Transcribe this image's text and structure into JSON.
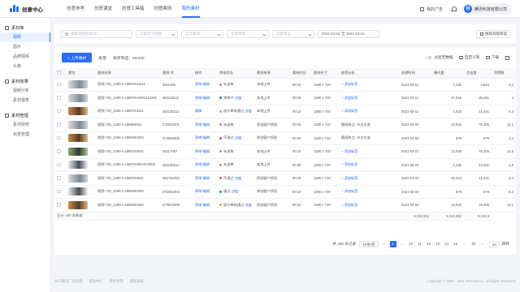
{
  "app": {
    "title": "创意中心"
  },
  "nav": [
    "创意参考",
    "创意课堂",
    "创意工具箱",
    "创意案例",
    "我的素材"
  ],
  "nav_active_index": 4,
  "header_right": {
    "ad_label": "我的广告",
    "user_initial": "腾",
    "user_name": "腾讯科技有限公司"
  },
  "sidebar": [
    {
      "label": "素材库",
      "items": [
        "视频",
        "图片",
        "品牌视频",
        "头像"
      ],
      "active_item": 0
    },
    {
      "label": "素材效果",
      "items": [
        "视频分析",
        "素材报表"
      ]
    },
    {
      "label": "素材管理",
      "items": [
        "素材授权",
        "标签管理"
      ]
    }
  ],
  "filters": {
    "search_placeholder": "搜索视频名称/ID",
    "selects": [
      "全部尺寸规格",
      "全部来源",
      "全部场景",
      "全部状态"
    ],
    "date_range": "2021-03-01 至 2021-04-01",
    "advanced": "视频高级筛选"
  },
  "toolbar": {
    "upload": "+ 上传素材",
    "tabs": [
      "批量",
      "排序筛选：20/100"
    ],
    "filter_toggle": "过滤无数据",
    "custom_columns": "自定义列",
    "download": "下载"
  },
  "table": {
    "columns": [
      "预览",
      "素材名称",
      "素材 ID",
      "操作",
      "审核状态",
      "素材来源",
      "素材时长",
      "素材尺寸",
      "推荐分析",
      "创建时间",
      "曝光量",
      "点击量",
      "消费数"
    ],
    "rows": [
      {
        "thumb": 0,
        "name": "视频-720_1280-1-15897541211",
        "id": "3611294",
        "ops": "预审 编辑",
        "status": "未送审",
        "status_color": "#999999",
        "source": "本地上传",
        "duration": "00:10",
        "size": "1280 x 720",
        "rec": "+ 添加标签",
        "created": "2021-03-11",
        "impr": "1,235",
        "clicks": "3,619",
        "cost": "6,3"
      },
      {
        "thumb": 0,
        "name": "视频-720_1280-1-15897541001210301",
        "id": "361126211",
        "ops": "预审 编辑",
        "status": "预审中",
        "status_color": "#2b6cf6",
        "source": "本地上传",
        "duration": "00:15",
        "size": "1280 x 720",
        "rec": "+ 添加标签",
        "created": "2021-03-11",
        "impr": "47,016",
        "clicks": "30,261",
        "cost": "4"
      },
      {
        "thumb": 1,
        "name": "视频-720_1280-1-1589754121",
        "id": "361126212",
        "ops": "编辑",
        "status": "部分审核通过",
        "status_color": "#f0a020",
        "source": "本地上传",
        "duration": "00:10",
        "size": "1280 x 720",
        "rec": "+ 添加标签",
        "created": "2021-03-11",
        "impr": "1,623",
        "clicks": "11,441",
        "cost": "6,4"
      },
      {
        "thumb": 0,
        "name": "视频-720_1280-1-158954001",
        "id": "372051001",
        "ops": "预审 编辑",
        "status": "未送审",
        "status_color": "#999999",
        "source": "原创客户授权",
        "duration": "00:10",
        "size": "1280 x 720",
        "rec": "情感热点, 节点水准",
        "created": "2021-03-09",
        "impr": "12,045",
        "clicks": "76,325",
        "cost": "11,1"
      },
      {
        "thumb": 1,
        "name": "视频-720_1280-1-1589494302",
        "id": "372052005",
        "ops": "预审 编辑",
        "status": "不通过",
        "status_color": "#e34d59",
        "source": "原创客户授权",
        "duration": "00:20",
        "size": "1280 x 720",
        "rec": "情感热点, 节点水准",
        "created": "2021-03-09",
        "impr": "679",
        "clicks": "679",
        "cost": "2,3"
      },
      {
        "thumb": 2,
        "name": "视频-720_1280-1-1589754001",
        "id": "36117057",
        "ops": "预审 编辑",
        "status": "未送审",
        "status_color": "#999999",
        "source": "本地上传",
        "duration": "00:10",
        "size": "1280 x 720",
        "rec": "+ 添加标签",
        "created": "2021-03-07",
        "impr": "12,045",
        "clicks": "76,325",
        "cost": "12,6"
      },
      {
        "thumb": 3,
        "name": "视频-720_1280-1-1589754001010006",
        "id": "361126212",
        "ops": "预审 编辑",
        "status": "未送审",
        "status_color": "#999999",
        "source": "本地上传",
        "duration": "00:30",
        "size": "1280 x 720",
        "rec": "+ 添加标签",
        "created": "2021-03-03",
        "impr": "1,235",
        "clicks": "43,561",
        "cost": "1,8"
      },
      {
        "thumb": 0,
        "name": "视频-720_1280-1-1589754001",
        "id": "361761062",
        "ops": "预审 编辑",
        "status": "不通过",
        "status_color": "#e34d59",
        "source": "原创客户授权",
        "duration": "00:10",
        "size": "1280 x 720",
        "rec": "+ 添加标签",
        "created": "2021-03-03",
        "impr": "20,410",
        "clicks": "11,441",
        "cost": "6,4"
      },
      {
        "thumb": 3,
        "name": "视频-720_1280-1-1589494302",
        "id": "372051002",
        "ops": "预审 编辑",
        "status": "通过",
        "status_color": "#00a870",
        "source": "原创客户授权",
        "duration": "00:10",
        "size": "1280 x 720",
        "rec": "+ 添加标签",
        "created": "2021-03-03",
        "impr": "679",
        "clicks": "679",
        "cost": "8,2"
      },
      {
        "thumb": 1,
        "name": "视频-720_1280-1-1589494302",
        "id": "373612006",
        "ops": "预审 编辑",
        "status": "部分审核通过",
        "status_color": "#f0a020",
        "source": "原创客户授权",
        "duration": "00:10",
        "size": "1280 x 720",
        "rec": "+ 添加标签",
        "created": "2021-03-03",
        "impr": "12,045",
        "clicks": "76,325",
        "cost": "11,1"
      }
    ],
    "detail_label": "详情",
    "footer": {
      "label": "总计: 400 条数据",
      "impr": "5,316,952",
      "clicks": "5,316,952",
      "cost": "5,316,9"
    }
  },
  "pagination": {
    "total": "共 400 条记录",
    "per_page": "10条/页",
    "pages": [
      "1",
      "...",
      "10",
      "11",
      "12",
      "13",
      "14",
      "15",
      "...",
      "40"
    ],
    "active": "1",
    "goto_value": "10",
    "goto_label": "跳转"
  },
  "footer": {
    "links": [
      "关于腾讯广告投放",
      "帮助中心",
      "服务条款",
      "隐私政策"
    ],
    "copyright": "Copyright © 1998 - 2021 Tencent Inc. All Rights Reserved"
  }
}
